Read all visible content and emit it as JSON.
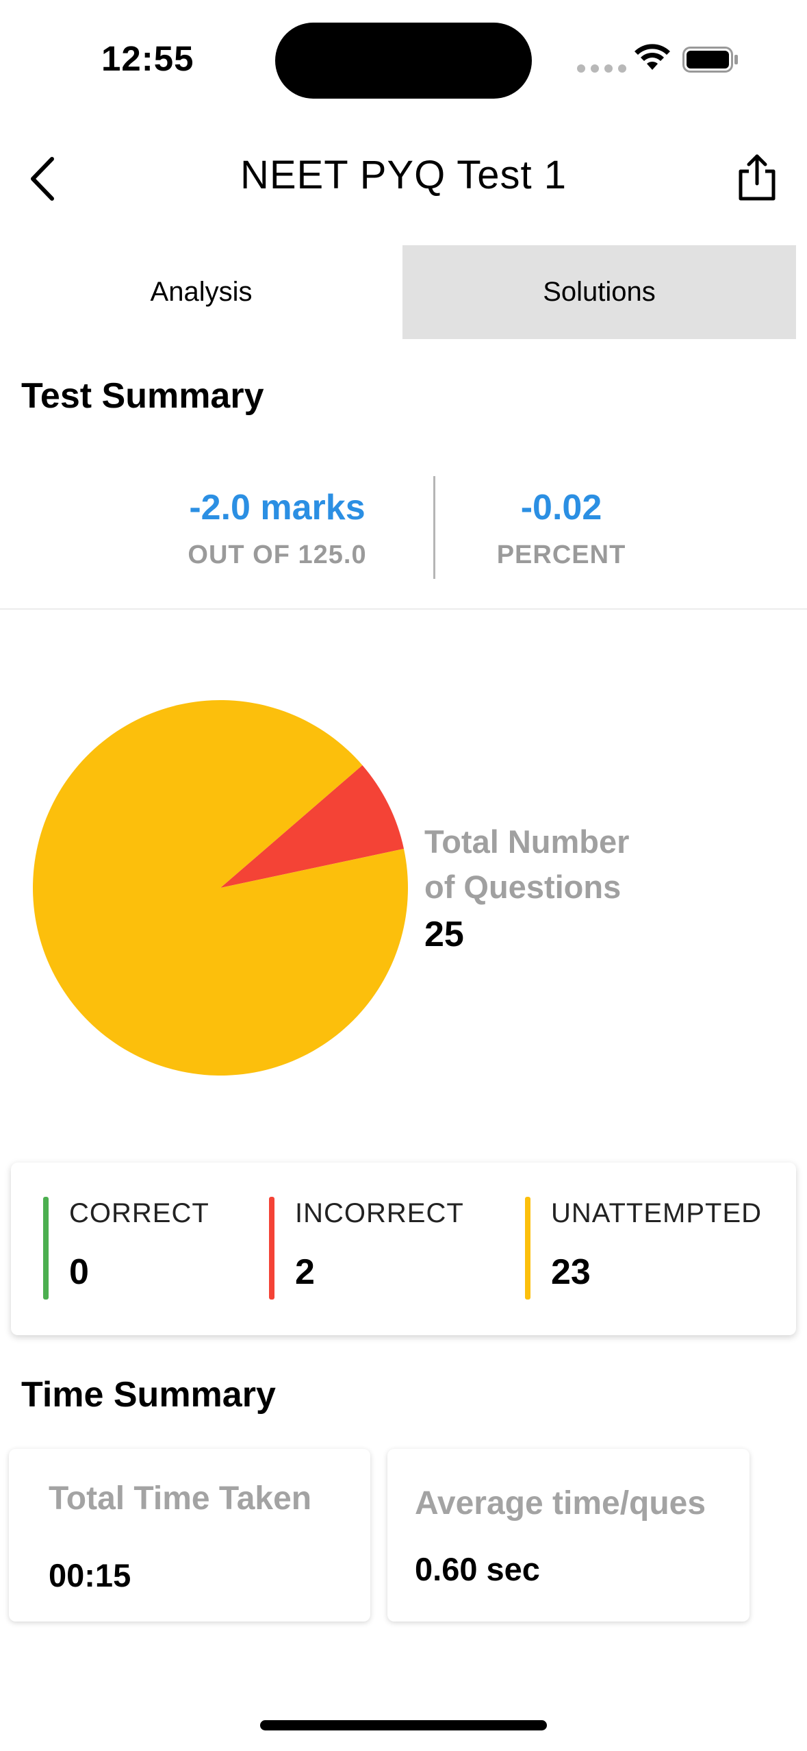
{
  "status_bar": {
    "time": "12:55"
  },
  "header": {
    "title": "NEET PYQ Test 1",
    "back_icon": "chevron-left-icon",
    "share_icon": "share-icon"
  },
  "tabs": [
    {
      "label": "Analysis",
      "selected": true
    },
    {
      "label": "Solutions",
      "selected": false
    }
  ],
  "test_summary": {
    "title": "Test Summary",
    "marks_value": "-2.0 marks",
    "marks_label": "OUT OF 125.0",
    "percent_value": "-0.02",
    "percent_label": "PERCENT"
  },
  "question_breakdown": {
    "caption_line1": "Total Number",
    "caption_line2": "of Questions",
    "total": "25",
    "slices": [
      {
        "label": "CORRECT",
        "value": 0,
        "color": "#4caf50"
      },
      {
        "label": "INCORRECT",
        "value": 2,
        "color": "#f44336"
      },
      {
        "label": "UNATTEMPTED",
        "value": 23,
        "color": "#fcbf0c"
      }
    ]
  },
  "stats": [
    {
      "label": "CORRECT",
      "value": "0",
      "color": "#4caf50"
    },
    {
      "label": "INCORRECT",
      "value": "2",
      "color": "#f44336"
    },
    {
      "label": "UNATTEMPTED",
      "value": "23",
      "color": "#fcbf0c"
    }
  ],
  "time_summary": {
    "title": "Time Summary",
    "total_label": "Total Time Taken",
    "total_value": "00:15",
    "average_label": "Average time/ques",
    "average_value": "0.60 sec"
  },
  "colors": {
    "accent_blue": "#2b8fe3",
    "correct": "#4caf50",
    "incorrect": "#f44336",
    "unattempted": "#fcbf0c",
    "muted_text": "#9a9a9a"
  }
}
